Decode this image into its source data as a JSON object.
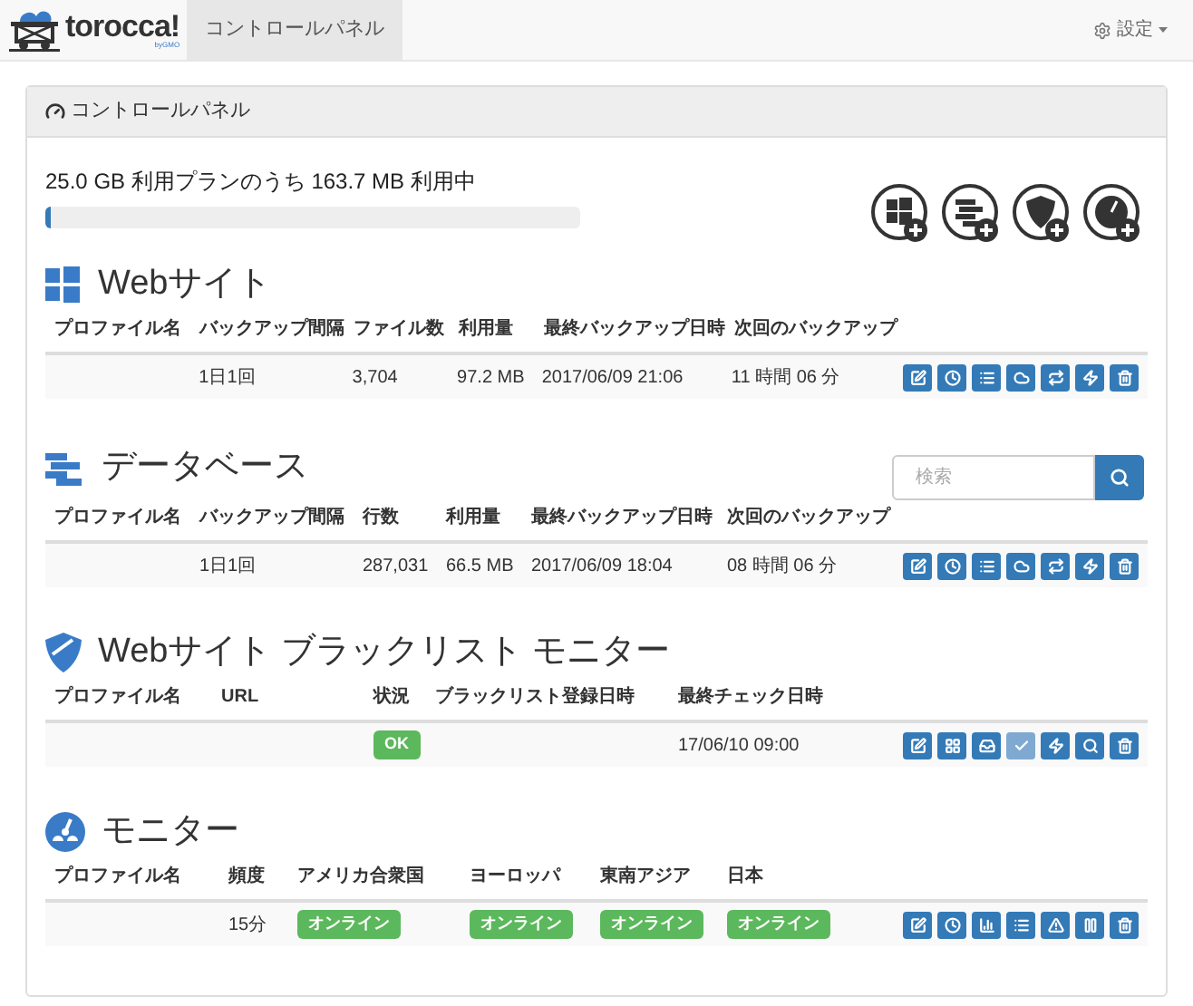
{
  "nav": {
    "brand": "torocca!",
    "brand_sub": "byGMO",
    "tabs": [
      {
        "label": "コントロールパネル",
        "selected": true
      }
    ],
    "settings": "設定"
  },
  "panel": {
    "title": "コントロールパネル",
    "usage": "25.0 GB 利用プランのうち 163.7 MB 利用中",
    "level": 0.01,
    "add_buttons": [
      {
        "kind": "website"
      },
      {
        "kind": "database"
      },
      {
        "kind": "shield"
      },
      {
        "kind": "monitor"
      }
    ]
  },
  "search": {
    "placeholder": "検索"
  },
  "sections": [
    {
      "kind": "website",
      "title": "Webサイト",
      "columns": [
        "プロファイル名",
        "バックアップ間隔",
        "ファイル数",
        "利用量",
        "最終バックアップ日時",
        "次回のバックアップ"
      ],
      "rows": [
        {
          "cells": [
            null,
            {
              "kind": "text",
              "text": "1日1回"
            },
            {
              "kind": "text",
              "text": "3,704"
            },
            {
              "kind": "text",
              "text": "97.2 MB"
            },
            {
              "kind": "text",
              "text": "2017/06/09 21:06"
            },
            {
              "kind": "text",
              "text": "11 時間 06 分"
            }
          ],
          "actions": [
            {
              "kind": "edit",
              "disabled": false
            },
            {
              "kind": "clock",
              "disabled": false
            },
            {
              "kind": "list",
              "disabled": false
            },
            {
              "kind": "cloud",
              "disabled": false
            },
            {
              "kind": "repeat",
              "disabled": false
            },
            {
              "kind": "bolt",
              "disabled": false
            },
            {
              "kind": "trash",
              "disabled": false
            }
          ]
        }
      ]
    },
    {
      "kind": "database",
      "title": "データベース",
      "columns": [
        "プロファイル名",
        "バックアップ間隔",
        "行数",
        "利用量",
        "最終バックアップ日時",
        "次回のバックアップ"
      ],
      "rows": [
        {
          "cells": [
            null,
            {
              "kind": "text",
              "text": "1日1回"
            },
            {
              "kind": "text",
              "text": "287,031"
            },
            {
              "kind": "text",
              "text": "66.5 MB"
            },
            {
              "kind": "text",
              "text": "2017/06/09 18:04"
            },
            {
              "kind": "text",
              "text": "08 時間 06 分"
            }
          ],
          "actions": [
            {
              "kind": "edit",
              "disabled": false
            },
            {
              "kind": "clock",
              "disabled": false
            },
            {
              "kind": "list",
              "disabled": false
            },
            {
              "kind": "cloud",
              "disabled": false
            },
            {
              "kind": "repeat",
              "disabled": false
            },
            {
              "kind": "bolt",
              "disabled": false
            },
            {
              "kind": "trash",
              "disabled": false
            }
          ]
        }
      ]
    },
    {
      "kind": "shield",
      "title": "Webサイト ブラックリスト モニター",
      "columns": [
        "プロファイル名",
        "URL",
        "状況",
        "ブラックリスト登録日時",
        "最終チェック日時"
      ],
      "rows": [
        {
          "cells": [
            null,
            null,
            {
              "kind": "badge",
              "text": "OK"
            },
            null,
            {
              "kind": "text",
              "text": "17/06/10 09:00"
            }
          ],
          "actions": [
            {
              "kind": "edit",
              "disabled": false
            },
            {
              "kind": "grid",
              "disabled": false
            },
            {
              "kind": "tray",
              "disabled": false
            },
            {
              "kind": "check",
              "disabled": true
            },
            {
              "kind": "bolt",
              "disabled": false
            },
            {
              "kind": "search",
              "disabled": false
            },
            {
              "kind": "trash",
              "disabled": false
            }
          ]
        }
      ]
    },
    {
      "kind": "monitor",
      "title": "モニター",
      "columns": [
        "プロファイル名",
        "頻度",
        "アメリカ合衆国",
        "ヨーロッパ",
        "東南アジア",
        "日本"
      ],
      "rows": [
        {
          "cells": [
            null,
            {
              "kind": "text",
              "text": "15分"
            },
            {
              "kind": "badge",
              "text": "オンライン"
            },
            {
              "kind": "badge",
              "text": "オンライン"
            },
            {
              "kind": "badge",
              "text": "オンライン"
            },
            {
              "kind": "badge",
              "text": "オンライン"
            }
          ],
          "actions": [
            {
              "kind": "edit",
              "disabled": false
            },
            {
              "kind": "clock",
              "disabled": false
            },
            {
              "kind": "chart",
              "disabled": false
            },
            {
              "kind": "list",
              "disabled": false
            },
            {
              "kind": "warning",
              "disabled": false
            },
            {
              "kind": "pause",
              "disabled": false
            },
            {
              "kind": "trash",
              "disabled": false
            }
          ]
        }
      ]
    }
  ]
}
